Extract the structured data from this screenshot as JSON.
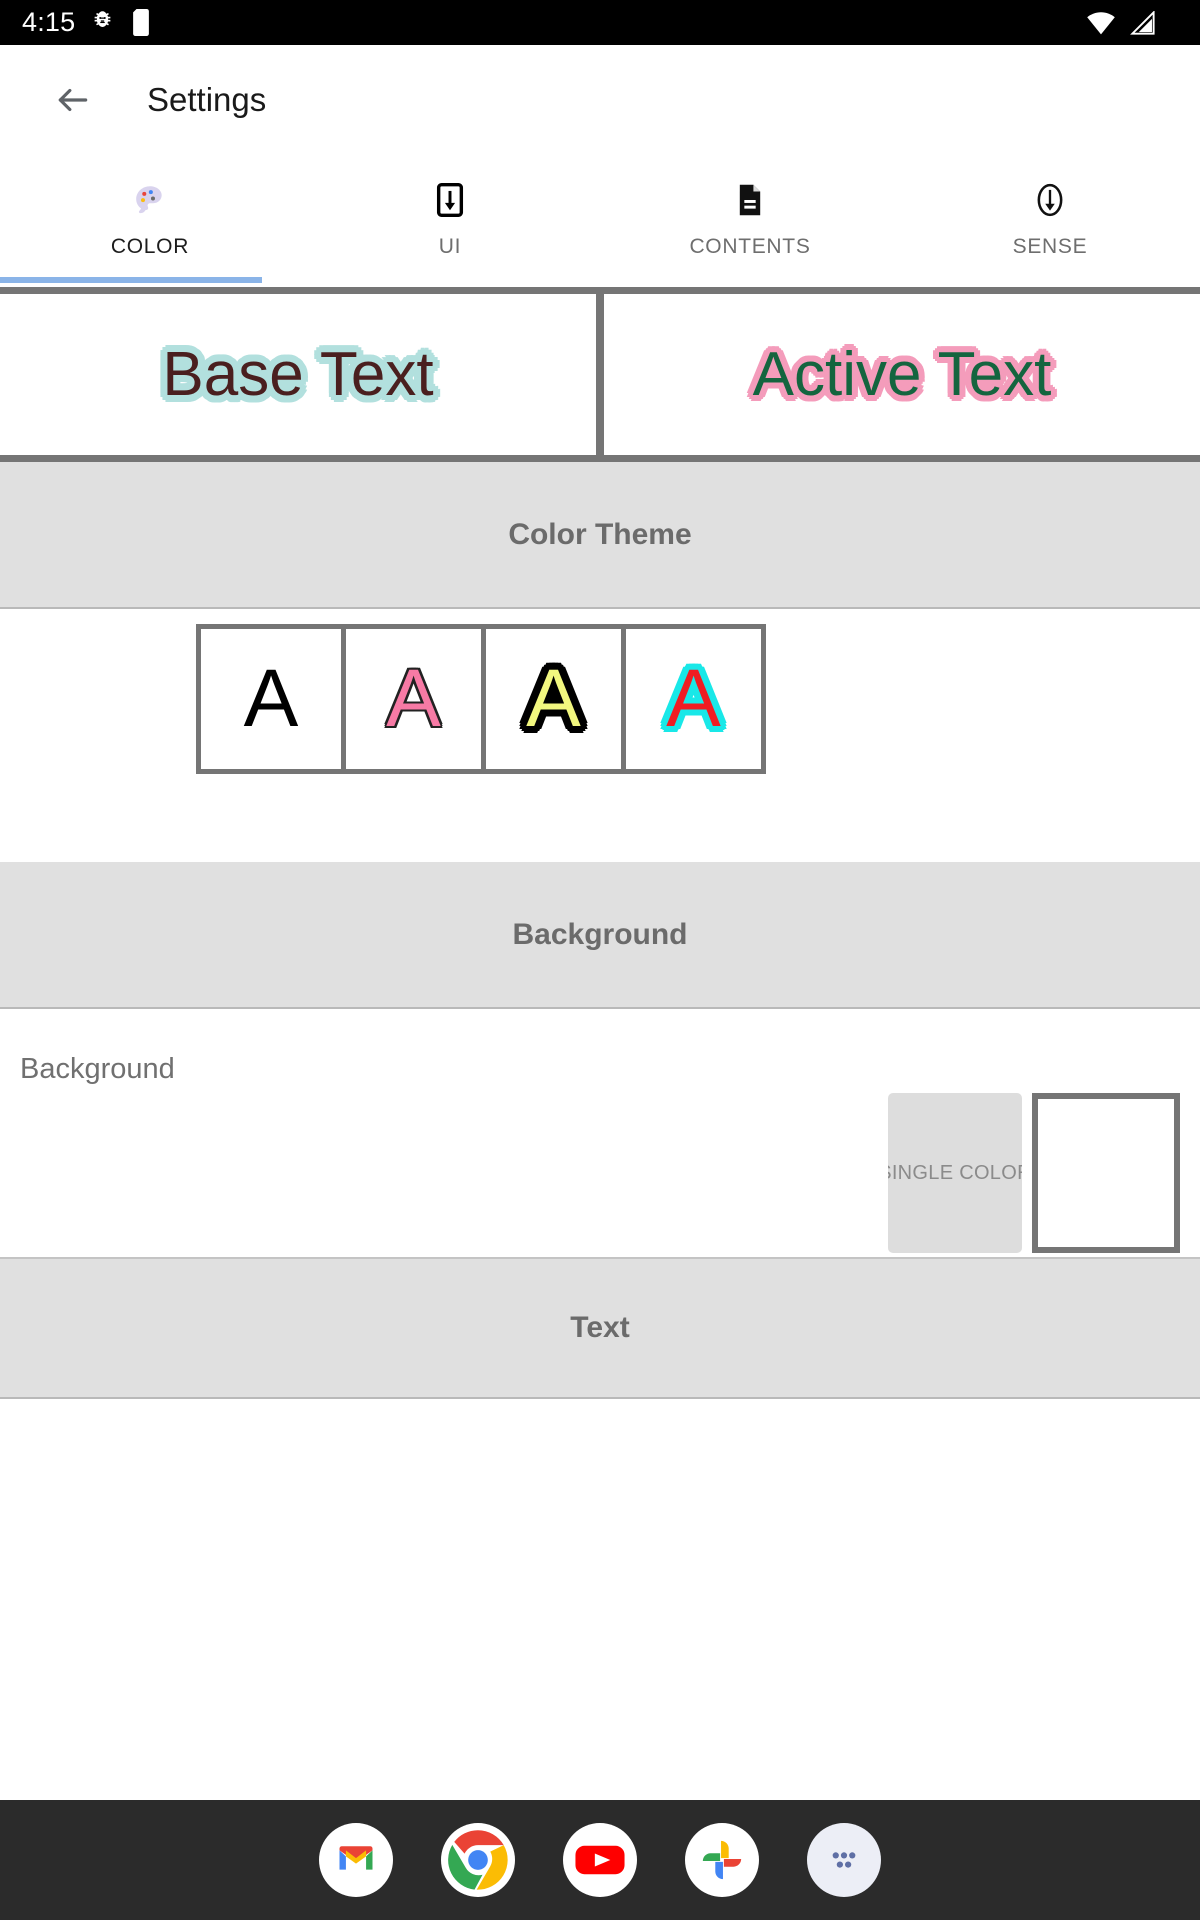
{
  "status_bar": {
    "time": "4:15",
    "left_icons": [
      "bug-icon",
      "sd-card-icon"
    ],
    "right_icons": [
      "wifi-icon",
      "cellular-signal-icon"
    ]
  },
  "app_bar": {
    "back_icon": "back-arrow-icon",
    "title": "Settings"
  },
  "tabs": {
    "active_index": 0,
    "indicator_color": "#8ab4e8",
    "items": [
      {
        "label": "COLOR",
        "icon": "palette-icon"
      },
      {
        "label": "UI",
        "icon": "download-to-phone-icon"
      },
      {
        "label": "CONTENTS",
        "icon": "document-icon"
      },
      {
        "label": "SENSE",
        "icon": "arrow-down-circle-icon"
      }
    ]
  },
  "preview": {
    "base": {
      "text": "Base Text",
      "fill_color": "#4a1f1f",
      "outline_color": "#b2e0de"
    },
    "active": {
      "text": "Active Text",
      "fill_color": "#14653f",
      "outline_color": "#f49cbb"
    }
  },
  "sections": {
    "color_theme": {
      "title": "Color Theme",
      "swatches": [
        {
          "letter": "A",
          "fill_color": "#000000",
          "outline_color": "#000000"
        },
        {
          "letter": "A",
          "fill_color": "#f77aa5",
          "outline_color": "#222222"
        },
        {
          "letter": "A",
          "fill_color": "#f2f77f",
          "outline_color": "#000000"
        },
        {
          "letter": "A",
          "fill_color": "#f01c22",
          "outline_color": "#19e8e8"
        }
      ]
    },
    "background": {
      "title": "Background",
      "row_label": "Background",
      "mode_button_label": "SINGLE COLOR",
      "color_preview_value": "#ffffff"
    },
    "text": {
      "title": "Text"
    }
  },
  "dock": {
    "items": [
      {
        "name": "gmail-icon"
      },
      {
        "name": "chrome-icon"
      },
      {
        "name": "youtube-icon"
      },
      {
        "name": "google-photos-icon"
      },
      {
        "name": "app-drawer-icon"
      }
    ]
  }
}
